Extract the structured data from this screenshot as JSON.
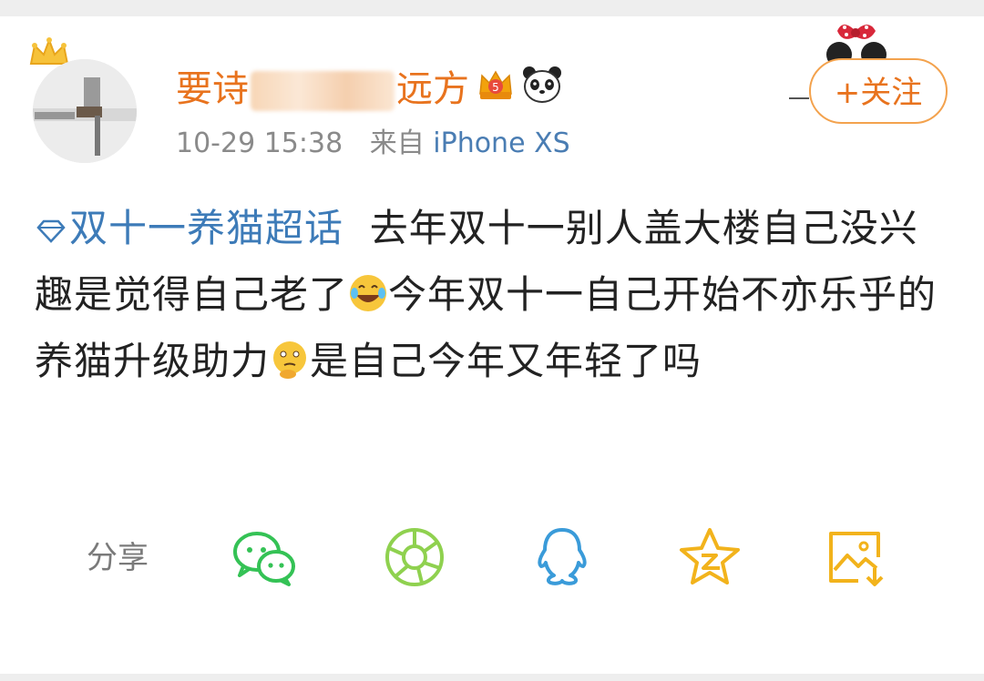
{
  "post": {
    "username_prefix": "要诗",
    "username_suffix": "远方",
    "timestamp": "10-29 15:38",
    "source_label": "来自",
    "device": "iPhone XS",
    "follow_label": "+关注",
    "topic": "双十一养猫超话",
    "text_parts": [
      "去年双十一别人盖大楼自己没兴趣是觉得自己老了",
      "今年双十一自己开始不亦乐乎的养猫升级助力",
      "是自己今年又年轻了吗"
    ]
  },
  "share": {
    "label": "分享",
    "targets": [
      "wechat",
      "wechat-moments",
      "qq",
      "qzone",
      "save-image"
    ]
  },
  "colors": {
    "username": "#e8731e",
    "topic_link": "#3d7bb8",
    "meta_text": "#8a8a8a",
    "follow_border": "#f3a24d",
    "wechat": "#34c255",
    "moments": "#8fd14f",
    "qq": "#3a9bd9",
    "qzone": "#f2b31c",
    "save": "#f2b31c"
  }
}
